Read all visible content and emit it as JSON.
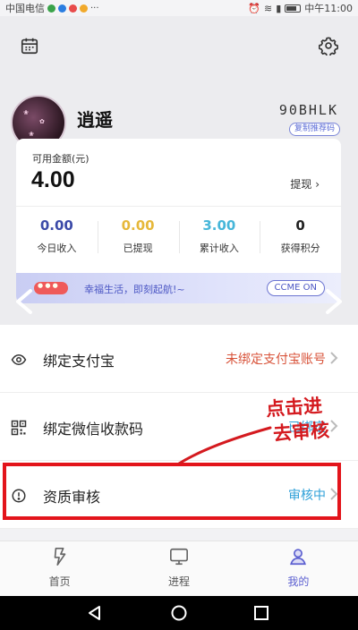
{
  "status_bar": {
    "carrier": "中国电信",
    "time": "中午11:00"
  },
  "profile": {
    "name": "逍遥",
    "referral_code": "90BHLK",
    "copy_label": "复制推荐码"
  },
  "balance": {
    "label": "可用金额(元)",
    "amount": "4.00",
    "withdraw_label": "提现"
  },
  "stats": [
    {
      "value": "0.00",
      "label": "今日收入",
      "color": "#3b4aa8"
    },
    {
      "value": "0.00",
      "label": "已提现",
      "color": "#e6b83a"
    },
    {
      "value": "3.00",
      "label": "累计收入",
      "color": "#46b6d9"
    },
    {
      "value": "0",
      "label": "获得积分",
      "color": "#222222"
    }
  ],
  "banner": {
    "text": "幸福生活，即刻起航!~",
    "cta": "CCME ON"
  },
  "menu": [
    {
      "label": "绑定支付宝",
      "status": "未绑定支付宝账号",
      "status_color": "#d8533a",
      "icon": "eye-icon"
    },
    {
      "label": "绑定微信收款码",
      "status": "已绑定",
      "status_color": "#2fa0d8",
      "icon": "qrcode-icon"
    },
    {
      "label": "资质审核",
      "status": "审核中",
      "status_color": "#2fa0d8",
      "icon": "alert-circle-icon"
    }
  ],
  "annotation": {
    "line1": "点击进",
    "line2": "去审核",
    "color": "#d41a1f"
  },
  "tabs": [
    {
      "label": "首页",
      "icon": "flash-icon",
      "active": false
    },
    {
      "label": "进程",
      "icon": "monitor-icon",
      "active": false
    },
    {
      "label": "我的",
      "icon": "user-icon",
      "active": true
    }
  ],
  "accent_color": "#5b5fd0"
}
